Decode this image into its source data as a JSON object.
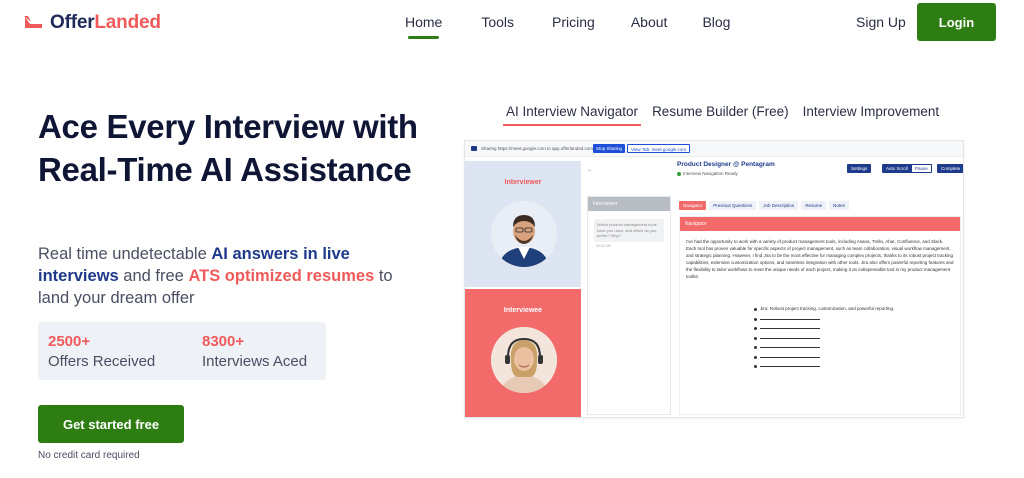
{
  "brand": {
    "name_part1": "Offer",
    "name_part2": "Landed",
    "accent": "#f05a5a",
    "dark": "#1e2a5a"
  },
  "nav": {
    "items": [
      {
        "label": "Home",
        "active": true
      },
      {
        "label": "Tools",
        "active": false
      },
      {
        "label": "Pricing",
        "active": false
      },
      {
        "label": "About",
        "active": false
      },
      {
        "label": "Blog",
        "active": false
      }
    ],
    "signup_label": "Sign Up",
    "login_label": "Login"
  },
  "hero": {
    "title": "Ace Every Interview with Real-Time AI Assistance",
    "sub_1": "Real time undetectable ",
    "sub_hl1": "AI answers in live interviews",
    "sub_2": " and free ",
    "sub_hl2": "ATS optimized resumes",
    "sub_3": " to land your dream offer",
    "stats": [
      {
        "number": "2500+",
        "label": "Offers Received"
      },
      {
        "number": "8300+",
        "label": "Interviews Aced"
      }
    ],
    "cta_label": "Get started free",
    "cta_note": "No credit card required"
  },
  "tabs": [
    {
      "label": "AI Interview Navigator",
      "active": true
    },
    {
      "label": "Resume Builder (Free)",
      "active": false
    },
    {
      "label": "Interview Improvement",
      "active": false
    }
  ],
  "mock": {
    "share_text": "Sharing https://meet.google.com to app.offerlanded.com",
    "stop_label": "Stop Sharing",
    "view_label": "View Tab: meet.google.com",
    "interviewer_label": "Interviewer",
    "interviewee_label": "Interviewee",
    "back_arrow": "←",
    "mid_head": "Interviewer",
    "mid_bubble": "Which product management tools have you used, and which do you prefer? Why?",
    "mid_time": "00:23 AM",
    "job_title": "Product Designer @ Pentagram",
    "job_status": "Interview Navigation Ready",
    "controls": {
      "settings": "Settings",
      "autoscroll": "Auto Scroll",
      "pause": "Pause",
      "complete": "Complete"
    },
    "subtabs": [
      {
        "label": "Navigator",
        "active": true
      },
      {
        "label": "Previous Questions",
        "active": false
      },
      {
        "label": "Job Description",
        "active": false
      },
      {
        "label": "Resume",
        "active": false
      },
      {
        "label": "Notes",
        "active": false
      }
    ],
    "nav_head": "Navigator",
    "nav_text": "I've had the opportunity to work with a variety of product management tools, including Asana, Trello, Aha!, Confluence, and Slack. Each tool has proven valuable for specific aspects of project management, such as team collaboration, visual workflow management, and strategic planning. However, I find Jira to be the most effective for managing complex projects, thanks to its robust project tracking capabilities, extensive customization options, and seamless integration with other tools. Jira also offers powerful reporting features and the flexibility to tailor workflows to meet the unique needs of each project, making it an indispensable tool in my product management toolkit.",
    "bullet_1": "Jira: Robust project tracking, customization, and powerful reporting."
  }
}
